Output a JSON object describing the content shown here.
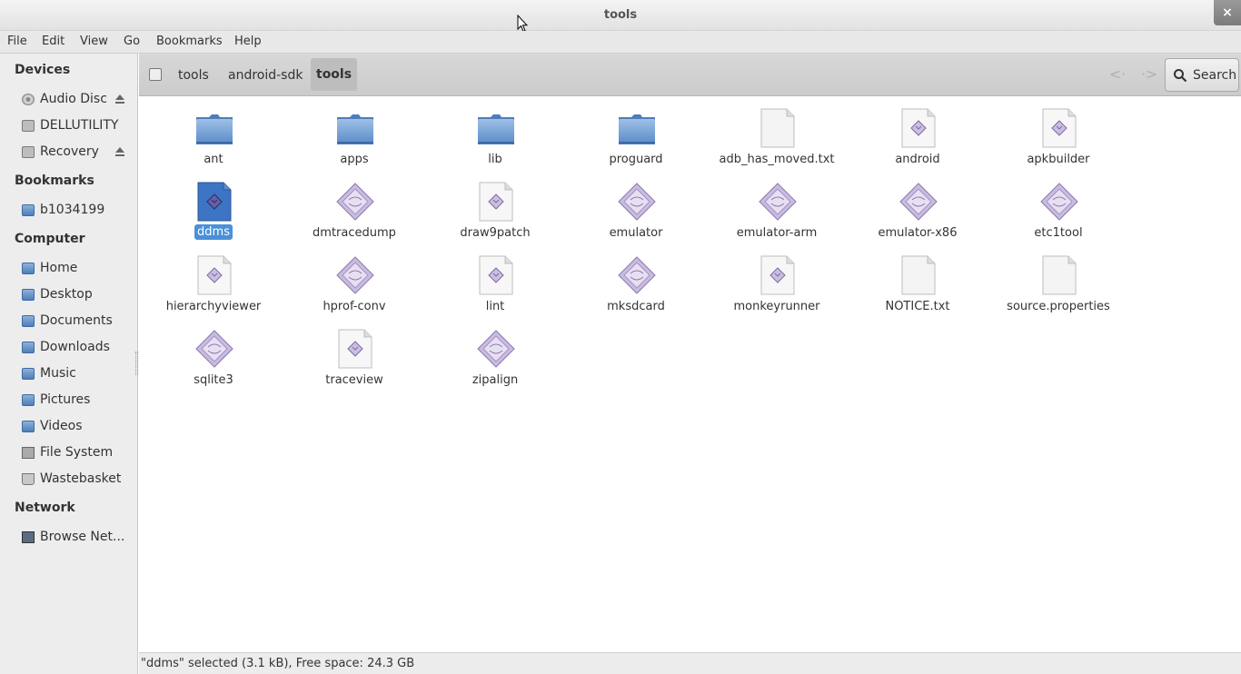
{
  "window": {
    "title": "tools",
    "close_glyph": "×"
  },
  "menubar": {
    "items": [
      "File",
      "Edit",
      "View",
      "Go",
      "Bookmarks",
      "Help"
    ]
  },
  "sidebar": {
    "sections": [
      {
        "heading": "Devices",
        "items": [
          {
            "label": "Audio Disc",
            "icon": "disc-icon",
            "eject": true
          },
          {
            "label": "DELLUTILITY",
            "icon": "drive-icon",
            "eject": false
          },
          {
            "label": "Recovery",
            "icon": "drive-icon",
            "eject": true
          }
        ]
      },
      {
        "heading": "Bookmarks",
        "items": [
          {
            "label": "b1034199",
            "icon": "folder-icon"
          }
        ]
      },
      {
        "heading": "Computer",
        "items": [
          {
            "label": "Home",
            "icon": "home-folder-icon"
          },
          {
            "label": "Desktop",
            "icon": "desktop-folder-icon"
          },
          {
            "label": "Documents",
            "icon": "documents-folder-icon"
          },
          {
            "label": "Downloads",
            "icon": "downloads-folder-icon"
          },
          {
            "label": "Music",
            "icon": "music-folder-icon"
          },
          {
            "label": "Pictures",
            "icon": "pictures-folder-icon"
          },
          {
            "label": "Videos",
            "icon": "videos-folder-icon"
          },
          {
            "label": "File System",
            "icon": "filesystem-icon"
          },
          {
            "label": "Wastebasket",
            "icon": "trash-icon"
          }
        ]
      },
      {
        "heading": "Network",
        "items": [
          {
            "label": "Browse Net...",
            "icon": "network-icon"
          }
        ]
      }
    ]
  },
  "pathbar": {
    "segments": [
      "tools",
      "android-sdk",
      "tools"
    ],
    "active_index": 2,
    "back_glyph": "<·",
    "forward_glyph": "·>",
    "search_label": "Search"
  },
  "files": [
    {
      "name": "ant",
      "type": "folder"
    },
    {
      "name": "apps",
      "type": "folder"
    },
    {
      "name": "lib",
      "type": "folder"
    },
    {
      "name": "proguard",
      "type": "folder"
    },
    {
      "name": "adb_has_moved.txt",
      "type": "text"
    },
    {
      "name": "android",
      "type": "script"
    },
    {
      "name": "apkbuilder",
      "type": "script"
    },
    {
      "name": "ddms",
      "type": "script",
      "selected": true
    },
    {
      "name": "dmtracedump",
      "type": "exec"
    },
    {
      "name": "draw9patch",
      "type": "script"
    },
    {
      "name": "emulator",
      "type": "exec"
    },
    {
      "name": "emulator-arm",
      "type": "exec"
    },
    {
      "name": "emulator-x86",
      "type": "exec"
    },
    {
      "name": "etc1tool",
      "type": "exec"
    },
    {
      "name": "hierarchyviewer",
      "type": "script"
    },
    {
      "name": "hprof-conv",
      "type": "exec"
    },
    {
      "name": "lint",
      "type": "script"
    },
    {
      "name": "mksdcard",
      "type": "exec"
    },
    {
      "name": "monkeyrunner",
      "type": "script"
    },
    {
      "name": "NOTICE.txt",
      "type": "text"
    },
    {
      "name": "source.properties",
      "type": "text"
    },
    {
      "name": "sqlite3",
      "type": "exec"
    },
    {
      "name": "traceview",
      "type": "script"
    },
    {
      "name": "zipalign",
      "type": "exec"
    }
  ],
  "status": {
    "text": "\"ddms\" selected (3.1 kB), Free space: 24.3 GB"
  },
  "colors": {
    "selection": "#4a90d9",
    "folder": "#6a95cc",
    "exec_diamond": "#b9a6d2"
  }
}
